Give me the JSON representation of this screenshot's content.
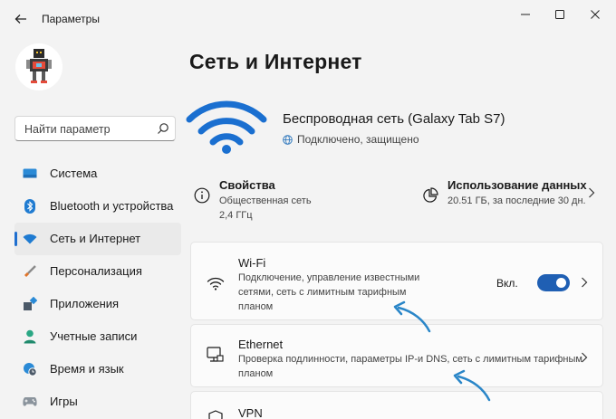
{
  "window": {
    "title": "Параметры",
    "controls": [
      "minimize-icon",
      "maximize-icon",
      "close-icon"
    ]
  },
  "search": {
    "placeholder": "Найти параметр"
  },
  "sidebar": {
    "items": [
      {
        "label": "Система",
        "icon": "system-icon",
        "active": false
      },
      {
        "label": "Bluetooth и устройства",
        "icon": "bluetooth-icon",
        "active": false
      },
      {
        "label": "Сеть и Интернет",
        "icon": "network-icon",
        "active": true
      },
      {
        "label": "Персонализация",
        "icon": "brush-icon",
        "active": false
      },
      {
        "label": "Приложения",
        "icon": "apps-icon",
        "active": false
      },
      {
        "label": "Учетные записи",
        "icon": "account-icon",
        "active": false
      },
      {
        "label": "Время и язык",
        "icon": "globe-clock-icon",
        "active": false
      },
      {
        "label": "Игры",
        "icon": "gamepad-icon",
        "active": false
      }
    ]
  },
  "main": {
    "title": "Сеть и Интернет",
    "connection": {
      "name": "Беспроводная сеть (Galaxy Tab S7)",
      "status": "Подключено, защищено"
    },
    "properties": {
      "title": "Свойства",
      "line1": "Общественная сеть",
      "line2": "2,4 ГГц"
    },
    "data_usage": {
      "title": "Использование данных",
      "line1": "20.51 ГБ, за последние 30 дн."
    },
    "cards": {
      "wifi": {
        "title": "Wi-Fi",
        "desc_line1": "Подключение, управление известными",
        "desc_line2": "сетями, сеть с лимитным тарифным",
        "desc_line3": "планом",
        "toggle_label": "Вкл.",
        "toggle_on": true
      },
      "ethernet": {
        "title": "Ethernet",
        "desc_line1": "Проверка подлинности, параметры IP-и DNS, сеть с лимитным тарифным",
        "desc_line2": "планом"
      },
      "vpn": {
        "title": "VPN"
      }
    }
  },
  "colors": {
    "accent": "#1f5fb3",
    "wifi_icon": "#1a6fd0",
    "annotation_arrow": "#2a86c8",
    "background": "#f3f3f3"
  }
}
